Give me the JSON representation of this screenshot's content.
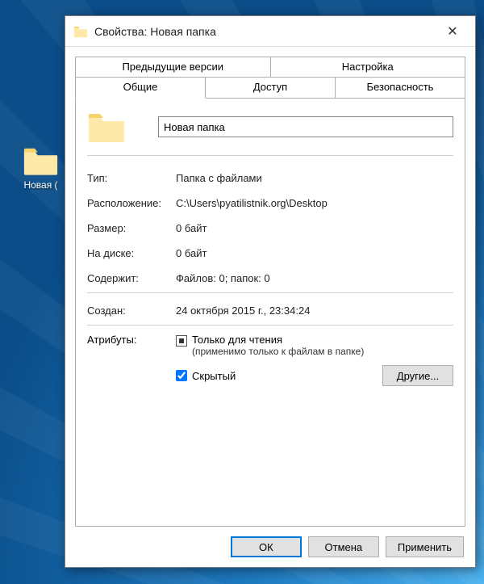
{
  "desktop": {
    "icon_label": "Новая (",
    "icon_name": "folder"
  },
  "dialog": {
    "title": "Свойства: Новая папка",
    "tabs": {
      "row1": [
        "Предыдущие версии",
        "Настройка"
      ],
      "row2": [
        "Общие",
        "Доступ",
        "Безопасность"
      ],
      "active": "Общие"
    },
    "folder_name": "Новая папка",
    "props": {
      "type_label": "Тип:",
      "type_value": "Папка с файлами",
      "location_label": "Расположение:",
      "location_value": "C:\\Users\\pyatilistnik.org\\Desktop",
      "size_label": "Размер:",
      "size_value": "0 байт",
      "ondisk_label": "На диске:",
      "ondisk_value": "0 байт",
      "contains_label": "Содержит:",
      "contains_value": "Файлов: 0; папок: 0",
      "created_label": "Создан:",
      "created_value": "24 октября 2015 г., 23:34:24"
    },
    "attributes": {
      "label": "Атрибуты:",
      "readonly_label": "Только для чтения",
      "readonly_sub": "(применимо только к файлам в папке)",
      "readonly_state": "indeterminate",
      "hidden_label": "Скрытый",
      "hidden_checked": true,
      "other_button": "Другие..."
    },
    "buttons": {
      "ok": "ОК",
      "cancel": "Отмена",
      "apply": "Применить"
    }
  }
}
